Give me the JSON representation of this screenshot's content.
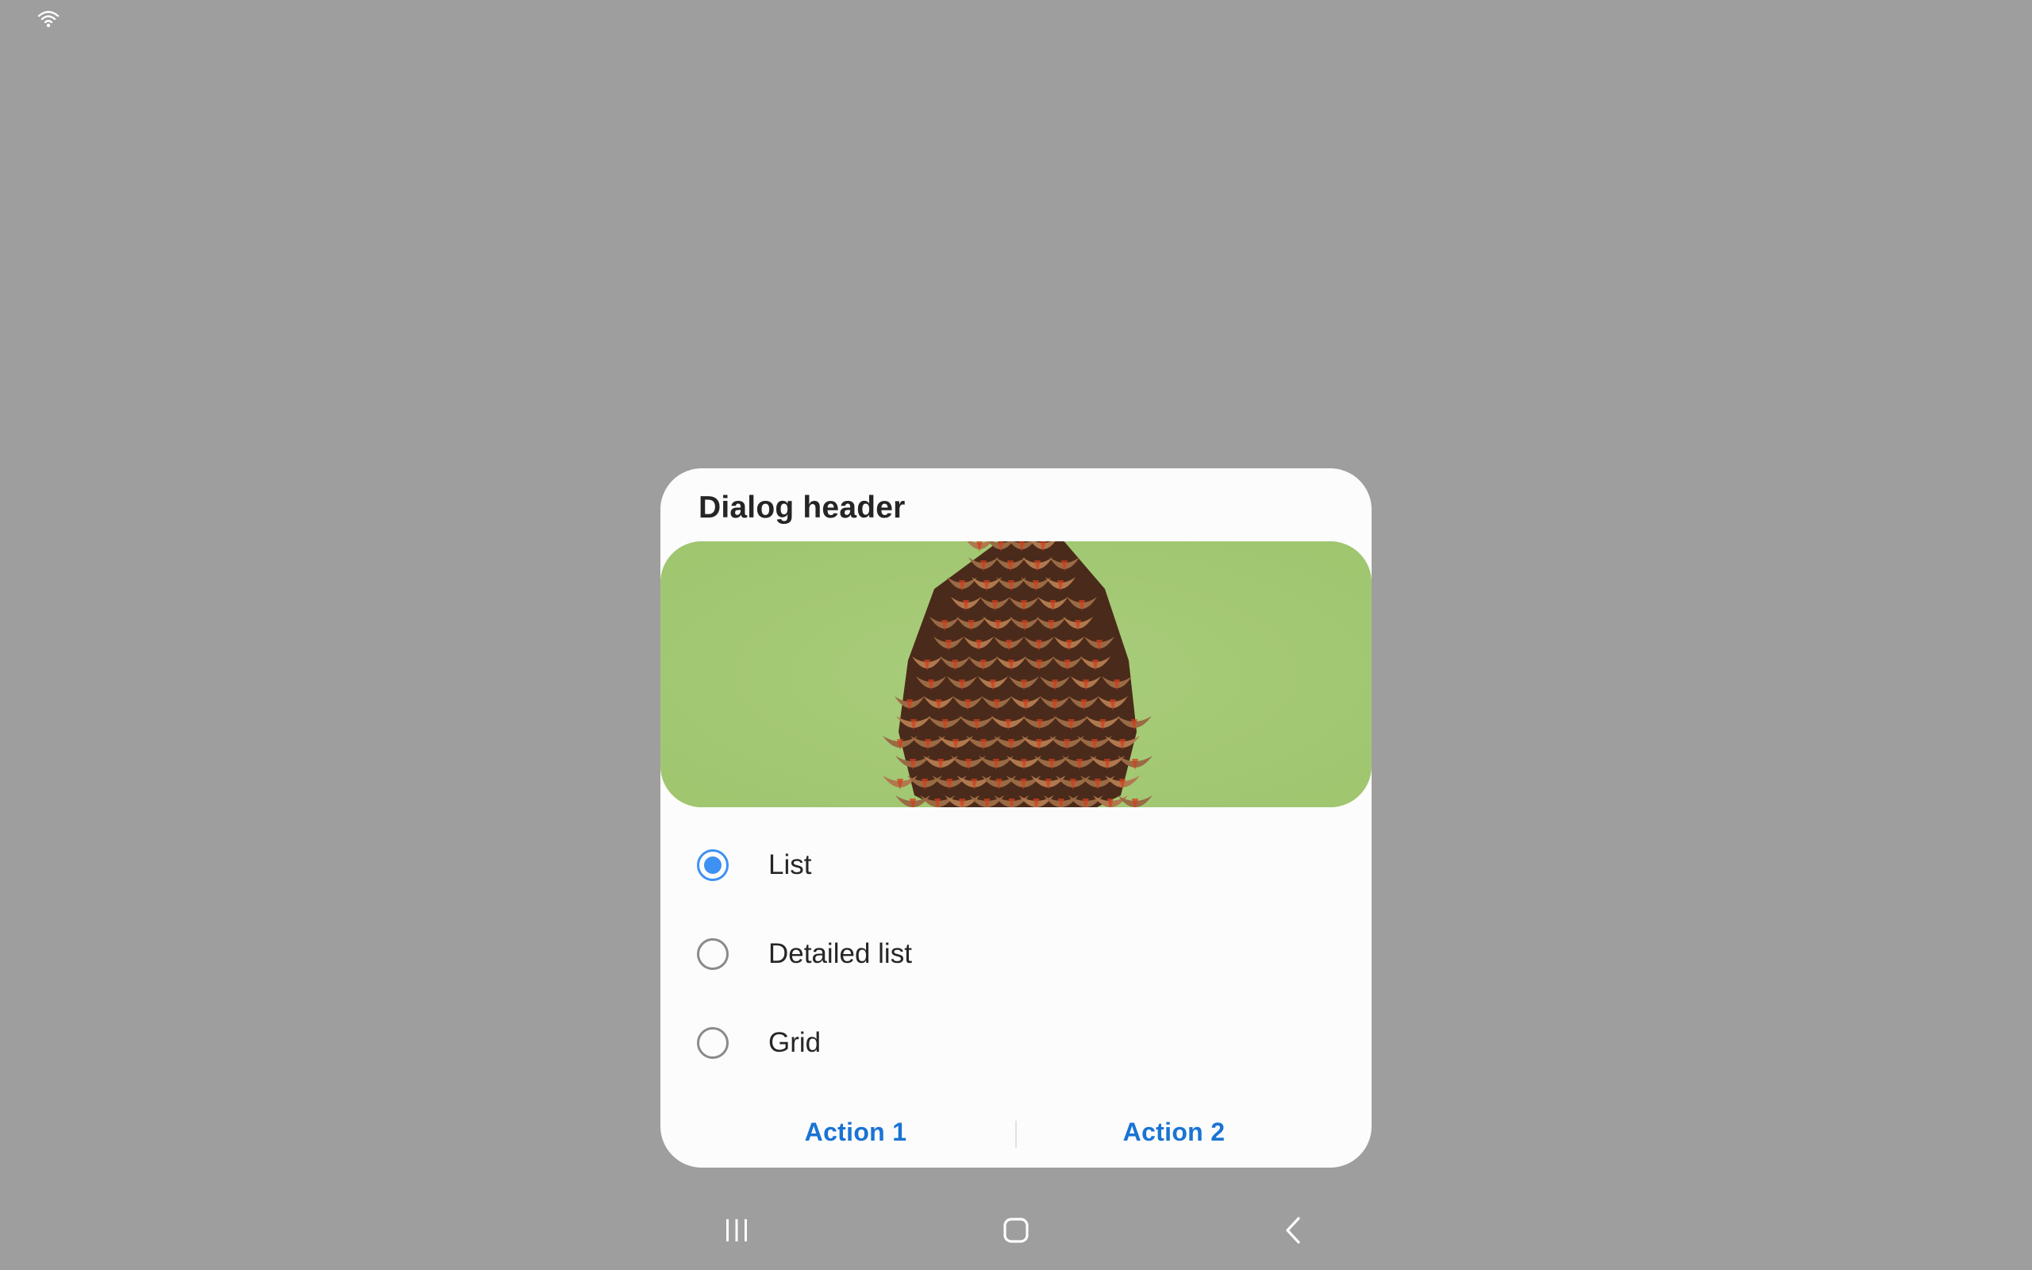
{
  "status_bar": {
    "icons": [
      "wifi-icon"
    ]
  },
  "dialog": {
    "header": "Dialog header",
    "image": "pine-cone-image",
    "options": [
      {
        "label": "List",
        "selected": true
      },
      {
        "label": "Detailed list",
        "selected": false
      },
      {
        "label": "Grid",
        "selected": false
      }
    ],
    "actions": {
      "action_1": "Action 1",
      "action_2": "Action 2"
    },
    "colors": {
      "accent": "#3e91f2",
      "action_text": "#1a73d4",
      "background": "#fcfcfc",
      "scrim": "#9e9e9e"
    }
  },
  "nav_bar": {
    "icons": [
      "recents-icon",
      "home-icon",
      "back-icon"
    ]
  }
}
